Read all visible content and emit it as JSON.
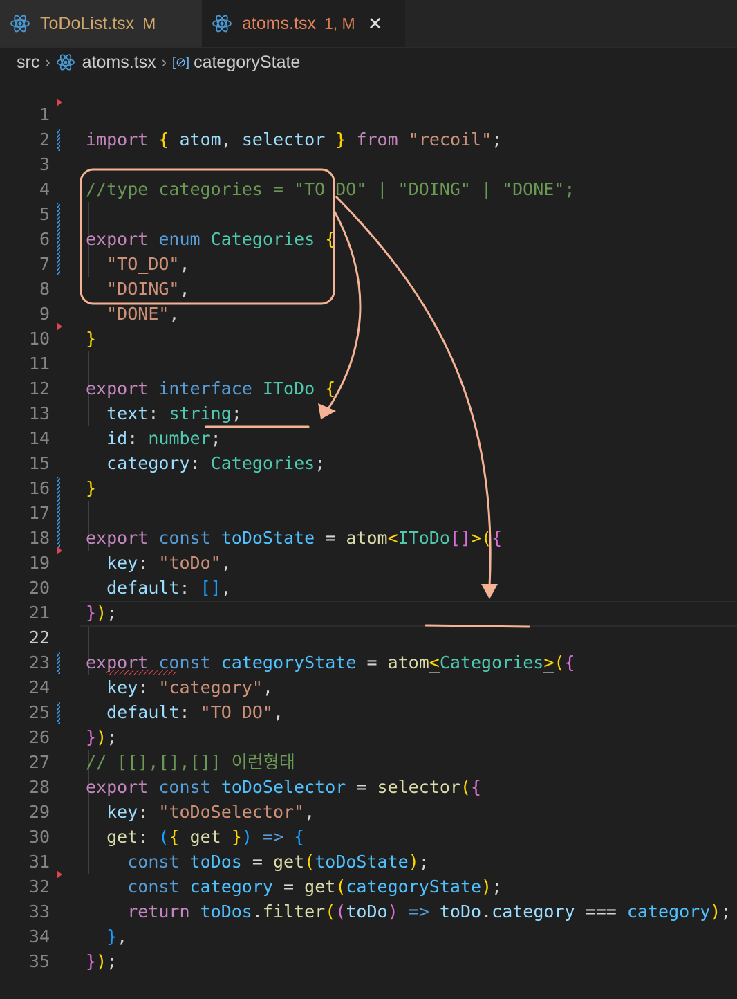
{
  "tabs": [
    {
      "label": "ToDoList.tsx",
      "status": "M",
      "icon": "react-icon"
    },
    {
      "label": "atoms.tsx",
      "status": "1, M",
      "icon": "react-icon",
      "close": "✕",
      "active": true
    }
  ],
  "breadcrumb": {
    "folder": "src",
    "file": "atoms.tsx",
    "symbol": "categoryState",
    "separator": "›",
    "symbol_icon": "[⊘]"
  },
  "colors": {
    "annotation": "#f5b396",
    "git_modified": "#3e91d8",
    "git_deleted": "#e0454f"
  },
  "line_numbers": [
    "1",
    "2",
    "3",
    "4",
    "5",
    "6",
    "7",
    "8",
    "9",
    "10",
    "11",
    "12",
    "13",
    "14",
    "15",
    "16",
    "17",
    "18",
    "19",
    "20",
    "21",
    "22",
    "23",
    "24",
    "25",
    "26",
    "27",
    "28",
    "29",
    "30",
    "31",
    "32",
    "33",
    "34",
    "35"
  ],
  "code": {
    "l1": [
      "import",
      "{",
      "atom",
      ",",
      "selector",
      "}",
      "from",
      "\"recoil\"",
      ";"
    ],
    "l3": "//type categories = \"TO_DO\" | \"DOING\" | \"DONE\";",
    "l5": [
      "export",
      "enum",
      "Categories",
      "{"
    ],
    "l6": [
      "\"TO_DO\"",
      ","
    ],
    "l7": [
      "\"DOING\"",
      ","
    ],
    "l8": [
      "\"DONE\"",
      ","
    ],
    "l9": "}",
    "l11": [
      "export",
      "interface",
      "IToDo",
      "{"
    ],
    "l12": [
      "text",
      ":",
      "string",
      ";"
    ],
    "l13": [
      "id",
      ":",
      "number",
      ";"
    ],
    "l14": [
      "category",
      ":",
      "Categories",
      ";"
    ],
    "l15": "}",
    "l17": [
      "export",
      "const",
      "toDoState",
      "=",
      "atom",
      "<",
      "IToDo",
      "[]",
      ">",
      "(",
      "{"
    ],
    "l18": [
      "key",
      ":",
      "\"toDo\"",
      ","
    ],
    "l19": [
      "default",
      ":",
      "[]",
      ","
    ],
    "l20": [
      "}",
      ")",
      ";"
    ],
    "l22": [
      "export",
      "const",
      "categoryState",
      "=",
      "atom",
      "<",
      "Categories",
      ">",
      "(",
      "{"
    ],
    "l23": [
      "key",
      ":",
      "\"category\"",
      ","
    ],
    "l24": [
      "default",
      ":",
      "\"TO_DO\"",
      ","
    ],
    "l25": [
      "}",
      ")",
      ";"
    ],
    "l26": "// [[],[],[]] 이런형태",
    "l27": [
      "export",
      "const",
      "toDoSelector",
      "=",
      "selector",
      "(",
      "{"
    ],
    "l28": [
      "key",
      ":",
      "\"toDoSelector\"",
      ","
    ],
    "l29": [
      "get",
      ":",
      "(",
      "{",
      "get",
      "}",
      ")",
      "=>",
      "{"
    ],
    "l30": [
      "const",
      "toDos",
      "=",
      "get",
      "(",
      "toDoState",
      ")",
      ";"
    ],
    "l31": [
      "const",
      "category",
      "=",
      "get",
      "(",
      "categoryState",
      ")",
      ";"
    ],
    "l32": [
      "return",
      "toDos",
      ".",
      "filter",
      "(",
      "(",
      "toDo",
      ")",
      "=>",
      "toDo",
      ".",
      "category",
      "===",
      "category",
      ")",
      ";"
    ],
    "l33": [
      "}",
      ","
    ],
    "l34": [
      "}",
      ")",
      ";"
    ]
  }
}
